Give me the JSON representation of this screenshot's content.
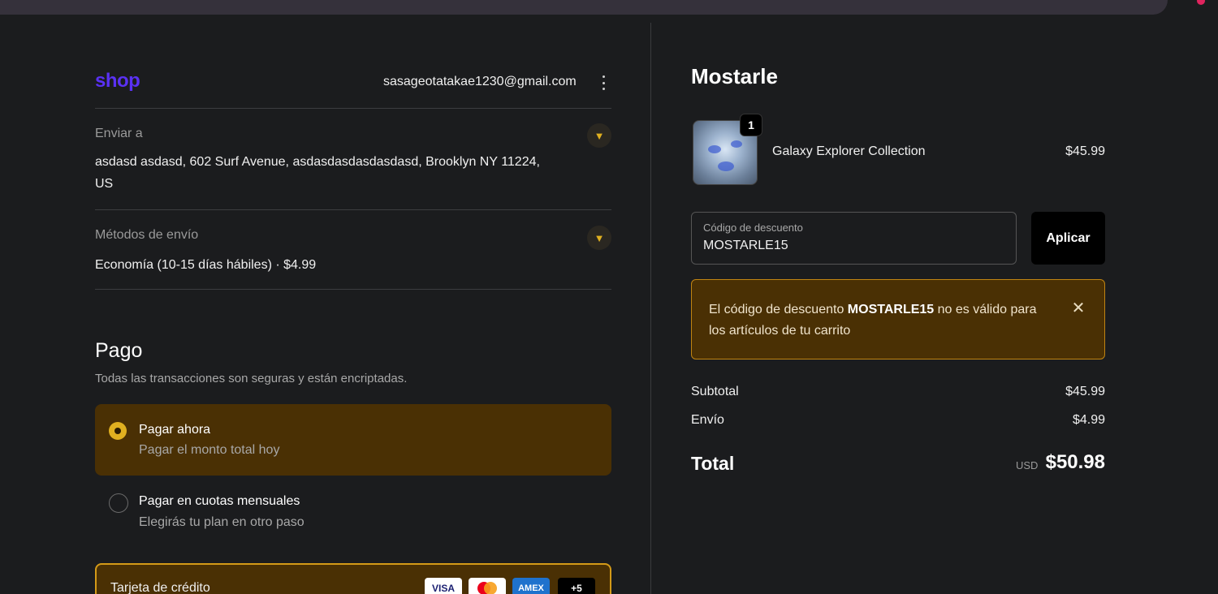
{
  "colors": {
    "accent": "#e0b020",
    "brand": "#5a31f4",
    "alert_bg": "#4a3004",
    "alert_border": "#c08412"
  },
  "header": {
    "logo_text": "shop",
    "email": "sasageotatakae1230@gmail.com",
    "menu_icon": "kebab-icon"
  },
  "shipping": {
    "label": "Enviar a",
    "address_line1": "asdasd asdasd, 602 Surf Avenue, asdasdasdasdasdasd, Brooklyn NY 11224,",
    "address_line2": "US"
  },
  "methods": {
    "label": "Métodos de envío",
    "value": "Economía (10-15 días hábiles) · $4.99"
  },
  "payment": {
    "title": "Pago",
    "subtitle": "Todas las transacciones son seguras y están encriptadas.",
    "options": [
      {
        "title": "Pagar ahora",
        "subtitle": "Pagar el monto total hoy",
        "selected": true
      },
      {
        "title": "Pagar en cuotas mensuales",
        "subtitle": "Elegirás tu plan en otro paso",
        "selected": false
      }
    ],
    "card_label": "Tarjeta de crédito",
    "brands": [
      "VISA",
      "",
      "AMEX",
      "+5"
    ]
  },
  "summary": {
    "store": "Mostarle",
    "item": {
      "name": "Galaxy Explorer Collection",
      "qty": "1",
      "price": "$45.99"
    },
    "discount": {
      "label": "Código de descuento",
      "value": "MOSTARLE15",
      "apply": "Aplicar"
    },
    "alert": {
      "prefix": "El código de descuento ",
      "code": "MOSTARLE15",
      "suffix": " no es válido para los artículos de tu carrito"
    },
    "subtotal_label": "Subtotal",
    "subtotal": "$45.99",
    "shipping_label": "Envío",
    "shipping": "$4.99",
    "total_label": "Total",
    "currency": "USD",
    "total": "$50.98"
  }
}
